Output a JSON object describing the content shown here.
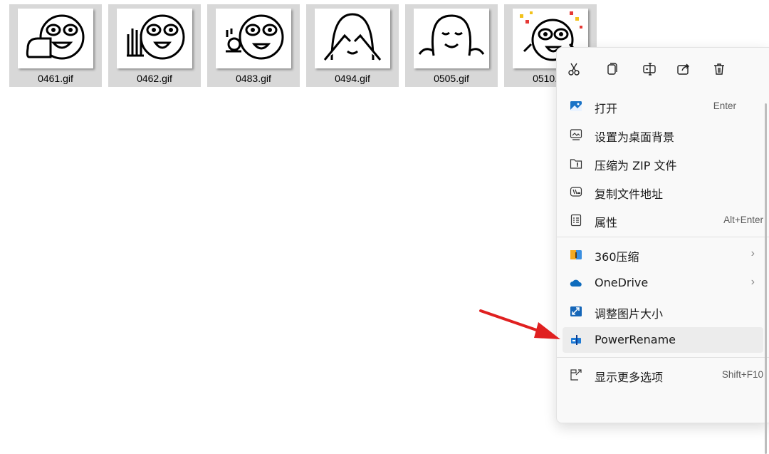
{
  "files": [
    {
      "name": "0461.gif",
      "icon": "fist-face-icon"
    },
    {
      "name": "0462.gif",
      "icon": "wave-face-icon"
    },
    {
      "name": "0483.gif",
      "icon": "ok-hand-face-icon"
    },
    {
      "name": "0494.gif",
      "icon": "cover-eyes-face-icon"
    },
    {
      "name": "0505.gif",
      "icon": "shrug-face-icon"
    },
    {
      "name": "0510.gif",
      "icon": "confetti-face-icon"
    }
  ],
  "quick_actions": [
    "cut-icon",
    "copy-icon",
    "rename-icon",
    "share-icon",
    "delete-icon"
  ],
  "menu": {
    "open": {
      "label": "打开",
      "shortcut": "Enter"
    },
    "set_wallpaper": {
      "label": "设置为桌面背景"
    },
    "compress_zip": {
      "label": "压缩为 ZIP 文件"
    },
    "copy_path": {
      "label": "复制文件地址"
    },
    "properties": {
      "label": "属性",
      "shortcut": "Alt+Enter"
    },
    "compress_360": {
      "label": "360压缩"
    },
    "onedrive": {
      "label": "OneDrive"
    },
    "resize_image": {
      "label": "调整图片大小"
    },
    "powerrename": {
      "label": "PowerRename"
    },
    "more_options": {
      "label": "显示更多选项",
      "shortcut": "Shift+F10"
    }
  },
  "colors": {
    "arrow": "#e02020",
    "accent": "#0067c0"
  }
}
